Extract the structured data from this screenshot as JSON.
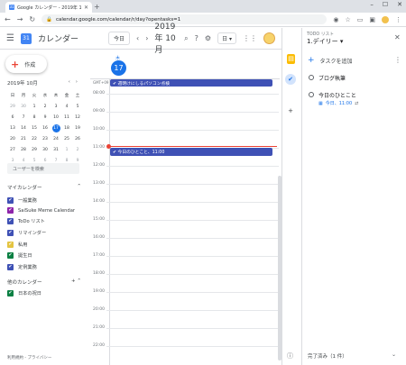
{
  "browser": {
    "tab_title": "Google カレンダー - 2019年 10月",
    "tab_favicon": "31",
    "url": "calendar.google.com/calendar/r/day?opentasks=1"
  },
  "header": {
    "logo_text": "31",
    "title": "カレンダー",
    "today_button": "今日",
    "date_title": "2019年 10月",
    "view_selector": "日 ▾"
  },
  "sidebar": {
    "create_label": "作成",
    "mini_cal": {
      "month": "2019年 10月",
      "weekdays": [
        "日",
        "月",
        "火",
        "水",
        "木",
        "金",
        "土"
      ],
      "weeks": [
        [
          "29",
          "30",
          "1",
          "2",
          "3",
          "4",
          "5"
        ],
        [
          "6",
          "7",
          "8",
          "9",
          "10",
          "11",
          "12"
        ],
        [
          "13",
          "14",
          "15",
          "16",
          "17",
          "18",
          "19"
        ],
        [
          "20",
          "21",
          "22",
          "23",
          "24",
          "25",
          "26"
        ],
        [
          "27",
          "28",
          "29",
          "30",
          "31",
          "1",
          "2"
        ],
        [
          "3",
          "4",
          "5",
          "6",
          "7",
          "8",
          "9"
        ]
      ],
      "selected": "17"
    },
    "user_search": "ユーザーを検索",
    "my_calendars_title": "マイカレンダー",
    "my_calendars": [
      {
        "label": "一般業務",
        "color": "#3f51b5"
      },
      {
        "label": "SaiSuke Meme Calendar",
        "color": "#8e24aa"
      },
      {
        "label": "ToDo リスト",
        "color": "#3f51b5"
      },
      {
        "label": "リマインダー",
        "color": "#3f51b5"
      },
      {
        "label": "私用",
        "color": "#e4c441"
      },
      {
        "label": "誕生日",
        "color": "#0b8043"
      },
      {
        "label": "定例業務",
        "color": "#3f51b5"
      }
    ],
    "other_calendars_title": "他のカレンダー",
    "other_calendars": [
      {
        "label": "日本の祝日",
        "color": "#0b8043"
      }
    ],
    "footer": "利用規約 - プライバシー"
  },
  "day_view": {
    "dow": "木",
    "day_number": "17",
    "tz_label": "GMT+09",
    "hours": [
      "08:00",
      "09:00",
      "10:00",
      "11:00",
      "12:00",
      "13:00",
      "14:00",
      "15:00",
      "16:00",
      "17:00",
      "18:00",
      "19:00",
      "20:00",
      "21:00",
      "22:00"
    ],
    "events": {
      "allday": "✔ 週明けにしるパソコン点検",
      "timed": "✔ 今日のひとこと、11:00"
    },
    "event_color": "#3f51b5",
    "now_color": "#ea4335"
  },
  "tasks": {
    "subtitle": "TODO リスト",
    "list_name": "1.デイリー ▾",
    "add_task": "タスクを追加",
    "items": [
      {
        "title": "ブログ執筆"
      },
      {
        "title": "今日のひとこと",
        "due": "今日、11:00"
      }
    ],
    "completed": "完了済み（1 件）"
  }
}
